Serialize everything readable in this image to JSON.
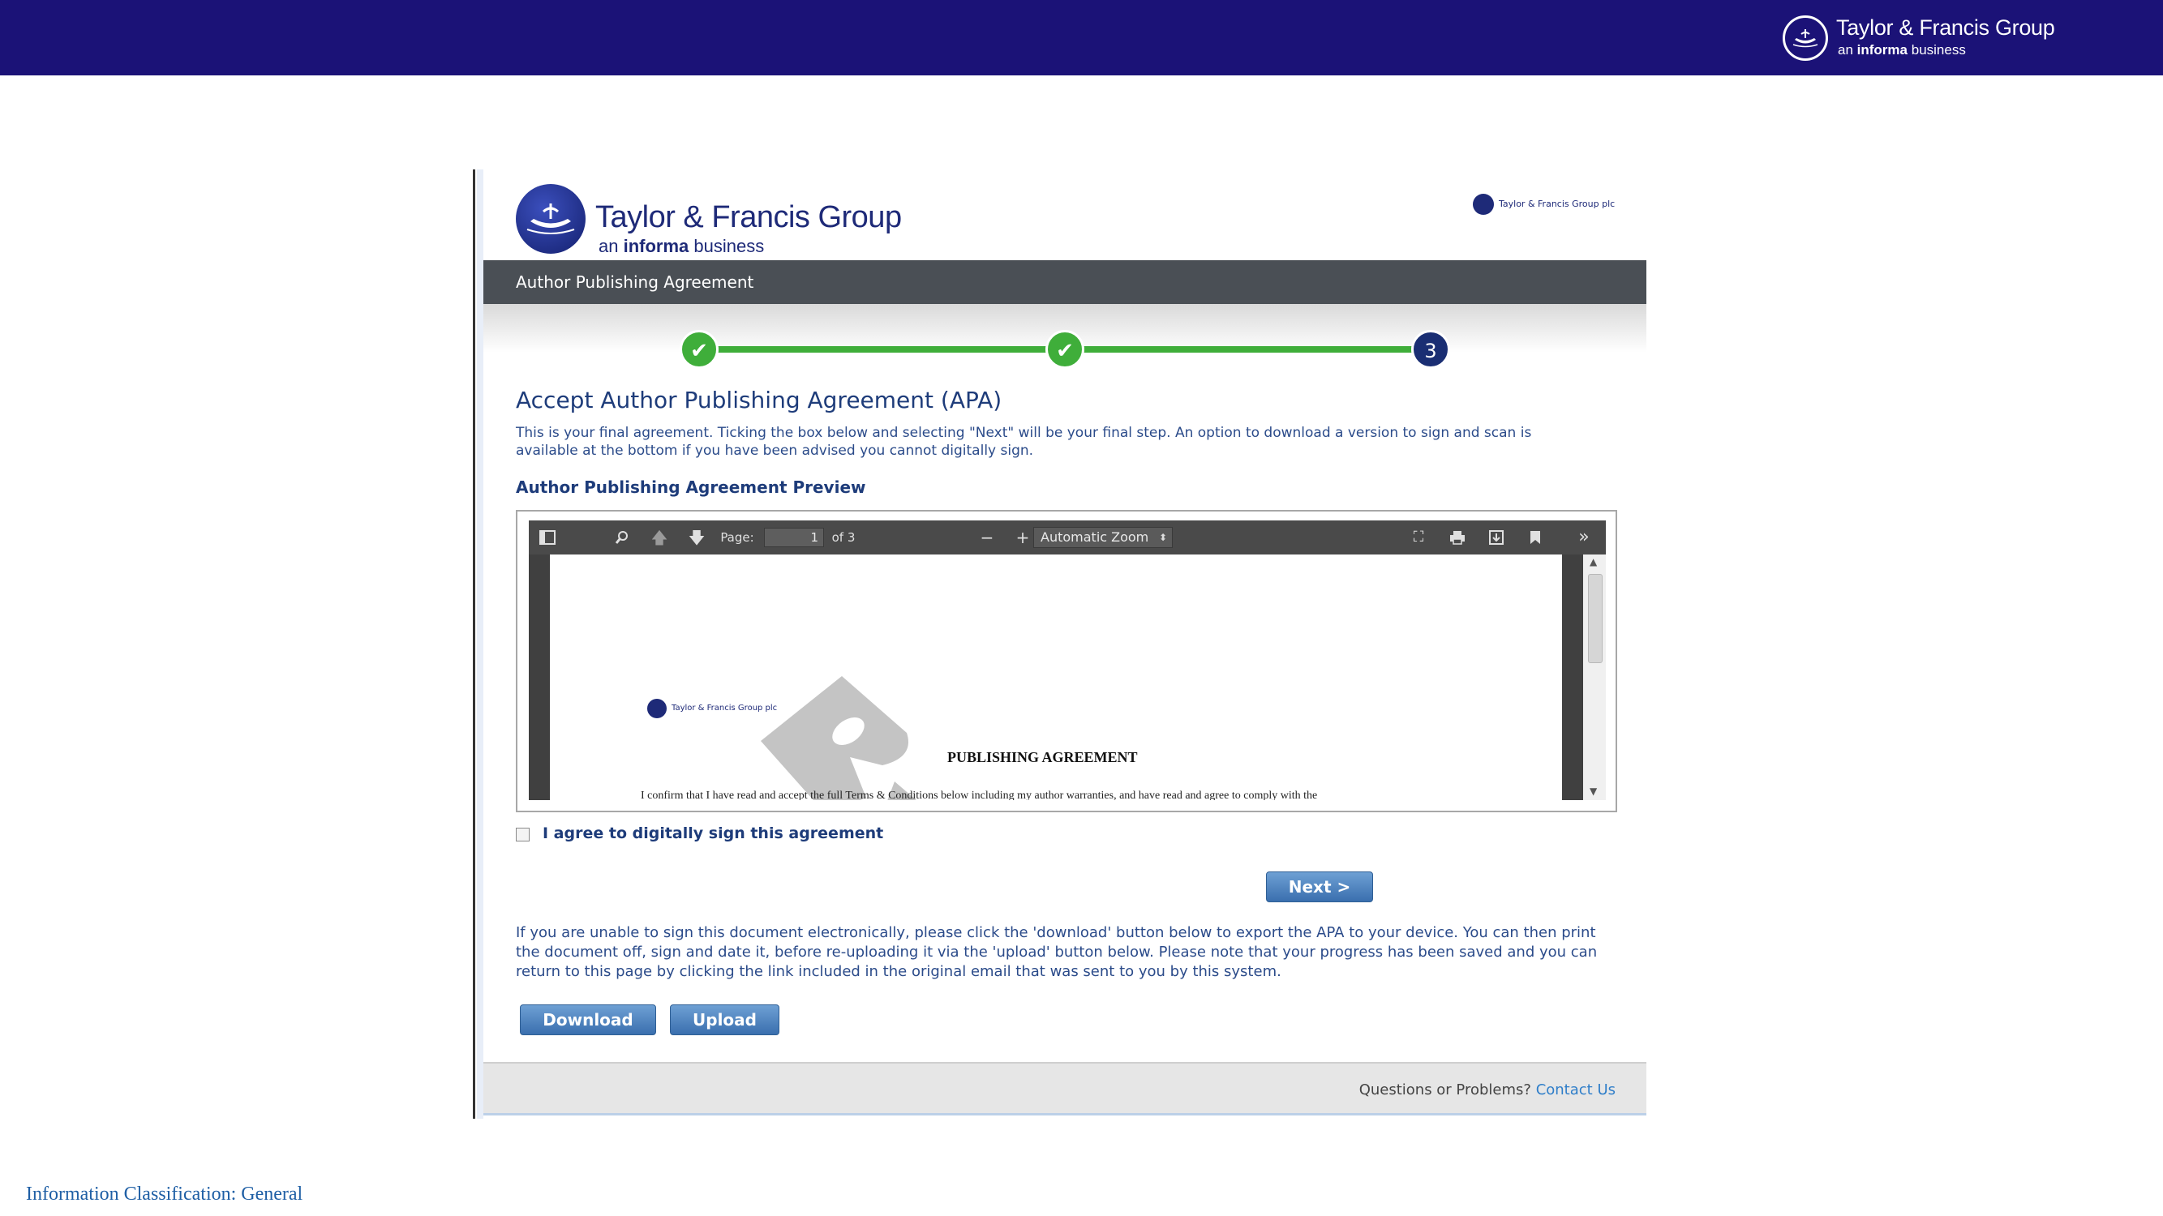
{
  "banner": {
    "brand": "Taylor & Francis Group",
    "sub_prefix": "an",
    "sub_bold": "informa",
    "sub_suffix": "business",
    "background": "#1b1277"
  },
  "header": {
    "brand": "Taylor & Francis Group",
    "sub_prefix": "an",
    "sub_bold": "informa",
    "sub_suffix": "business",
    "small_logo": "Taylor & Francis Group plc"
  },
  "apa_bar": {
    "label": "Author Publishing Agreement"
  },
  "progress": {
    "steps": [
      {
        "state": "complete",
        "glyph": "✔"
      },
      {
        "state": "complete",
        "glyph": "✔"
      },
      {
        "state": "current",
        "glyph": "3"
      }
    ],
    "complete_color": "#3fae3a",
    "current_color": "#1a2e73"
  },
  "main": {
    "heading": "Accept Author Publishing Agreement (APA)",
    "intro": "This is your final agreement. Ticking the box below and selecting \"Next\" will be your final step. An option to download a version to sign and scan is available at the bottom if you have been advised you cannot digitally sign.",
    "preview_heading": "Author Publishing Agreement Preview"
  },
  "pdf_viewer": {
    "icons": {
      "sidebar": "sidebar-toggle-icon",
      "find": "search-icon",
      "previous": "arrow-up-icon",
      "next": "arrow-down-icon",
      "zoom_out": "minus-icon",
      "zoom_in": "plus-icon",
      "presentation": "fullscreen-icon",
      "print": "printer-icon",
      "download": "download-icon",
      "bookmark": "bookmark-icon",
      "tools": "double-chevron-right-icon"
    },
    "page_label": "Page:",
    "page_value": "1",
    "page_of": "of 3",
    "zoom": "Automatic Zoom",
    "document": {
      "logo_text": "Taylor & Francis Group plc",
      "title": "PUBLISHING AGREEMENT",
      "body_line": "I confirm that I have read and accept the full Terms & Conditions below including my author warranties, and have read and agree to comply with the"
    }
  },
  "agree": {
    "label": "I agree to digitally sign this agreement",
    "checked": false
  },
  "buttons": {
    "next": "Next >",
    "download": "Download",
    "upload": "Upload"
  },
  "offline_text": "If you are unable to sign this document electronically, please click the 'download' button below to export the APA to your device. You can then print the document off, sign and date it, before re-uploading it via the 'upload' button below. Please note that your progress has been saved and you can return to this page by clicking the link included in the original email that was sent to you by this system.",
  "footer": {
    "question": "Questions or Problems?",
    "contact": "Contact Us",
    "link_color": "#2f7ec9"
  },
  "classification": "Information Classification: General"
}
